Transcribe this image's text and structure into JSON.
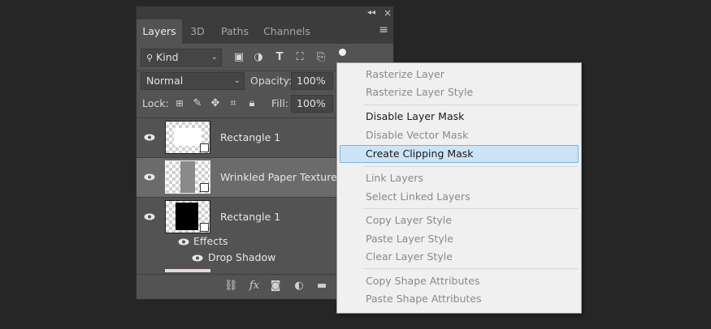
{
  "panel": {
    "tabs": [
      {
        "label": "Layers"
      },
      {
        "label": "3D"
      },
      {
        "label": "Paths"
      },
      {
        "label": "Channels"
      }
    ],
    "window_controls": {
      "collapse": "◂◂",
      "close": "×"
    },
    "panel_menu_icon": "hamburger-icon",
    "filter": {
      "label": "Kind"
    },
    "blend_mode": "Normal",
    "opacity_label": "Opacity:",
    "opacity_value": "100%",
    "lock_label": "Lock:",
    "fill_label": "Fill:",
    "fill_value": "100%",
    "layers": [
      {
        "name": "Rectangle 1",
        "visible": true
      },
      {
        "name": "Wrinkled Paper Texture",
        "visible": true,
        "selected": true
      },
      {
        "name": "Rectangle 1",
        "visible": true
      }
    ],
    "effects_label": "Effects",
    "drop_shadow_label": "Drop Shadow"
  },
  "context_menu": {
    "items": [
      {
        "label": "Rasterize Layer",
        "enabled": false
      },
      {
        "label": "Rasterize Layer Style",
        "enabled": false
      },
      {
        "label": "Disable Layer Mask",
        "enabled": true
      },
      {
        "label": "Disable Vector Mask",
        "enabled": false
      },
      {
        "label": "Create Clipping Mask",
        "enabled": true,
        "highlighted": true
      },
      {
        "label": "Link Layers",
        "enabled": false
      },
      {
        "label": "Select Linked Layers",
        "enabled": false
      },
      {
        "label": "Copy Layer Style",
        "enabled": false
      },
      {
        "label": "Paste Layer Style",
        "enabled": false
      },
      {
        "label": "Clear Layer Style",
        "enabled": false
      },
      {
        "label": "Copy Shape Attributes",
        "enabled": false
      },
      {
        "label": "Paste Shape Attributes",
        "enabled": false
      }
    ]
  },
  "colors": {
    "background": "#262626",
    "panel": "#535353",
    "menu": "#f0f0f0",
    "highlight": "#cce4f7"
  }
}
